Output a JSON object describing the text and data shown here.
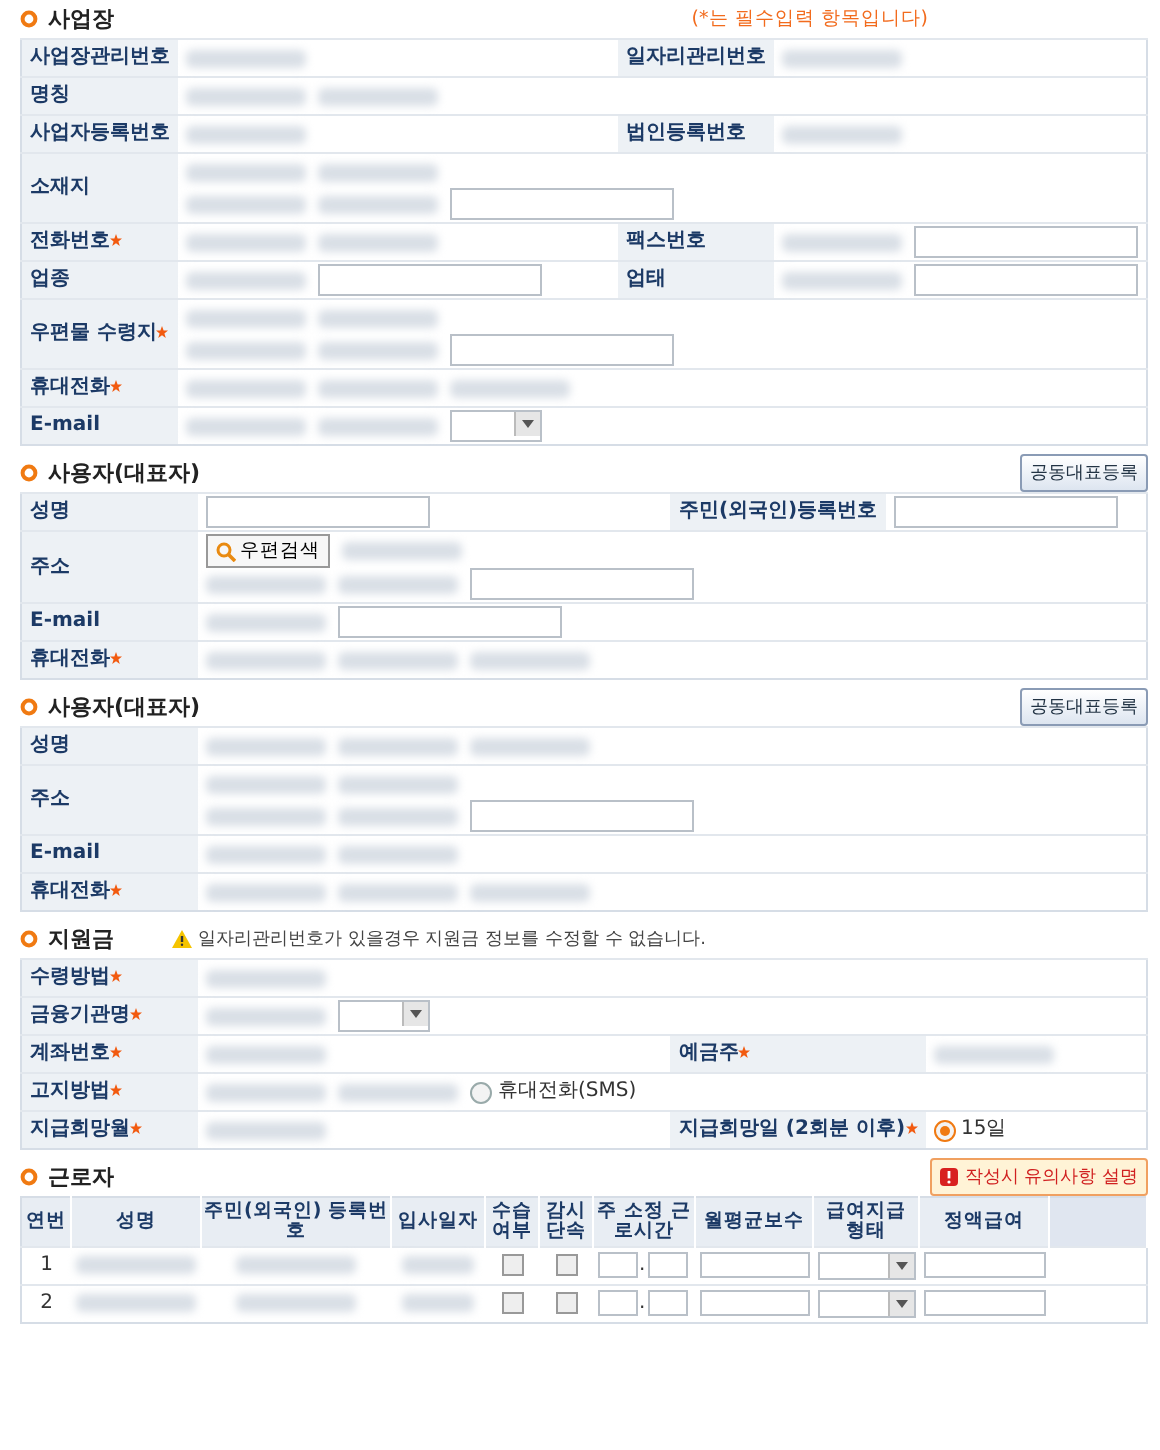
{
  "sections": [
    {
      "kind": "form",
      "title": "사업장",
      "notice": {
        "kind": "hint",
        "text": "(*는 필수입력 항목입니다)"
      },
      "rows": [
        {
          "label": "사업장관리번호",
          "required": false,
          "lines": [
            [
              {
                "kind": "blur"
              }
            ]
          ],
          "label2": "일자리관리번호",
          "required2": false,
          "lines2": [
            [
              {
                "kind": "blur"
              }
            ]
          ]
        },
        {
          "label": "명칭",
          "required": false,
          "lines": [
            [
              {
                "kind": "blur"
              },
              {
                "kind": "blur"
              }
            ]
          ]
        },
        {
          "label": "사업자등록번호",
          "required": false,
          "lines": [
            [
              {
                "kind": "blur"
              }
            ]
          ],
          "label2": "법인등록번호",
          "required2": false,
          "lines2": [
            [
              {
                "kind": "blur"
              }
            ]
          ]
        },
        {
          "label": "소재지",
          "required": false,
          "lines": [
            [
              {
                "kind": "blur"
              },
              {
                "kind": "blur"
              }
            ],
            [
              {
                "kind": "blur"
              },
              {
                "kind": "blur"
              },
              {
                "kind": "field"
              }
            ]
          ]
        },
        {
          "label": "전화번호",
          "required": true,
          "lines": [
            [
              {
                "kind": "blur"
              },
              {
                "kind": "blur"
              }
            ]
          ],
          "label2": "팩스번호",
          "required2": false,
          "lines2": [
            [
              {
                "kind": "blur"
              },
              {
                "kind": "field"
              }
            ]
          ]
        },
        {
          "label": "업종",
          "required": false,
          "lines": [
            [
              {
                "kind": "blur"
              },
              {
                "kind": "field"
              }
            ]
          ],
          "label2": "업태",
          "required2": false,
          "lines2": [
            [
              {
                "kind": "blur"
              },
              {
                "kind": "field"
              }
            ]
          ]
        },
        {
          "label": "우편물 수령지",
          "required": true,
          "lines": [
            [
              {
                "kind": "blur"
              },
              {
                "kind": "blur"
              }
            ],
            [
              {
                "kind": "blur"
              },
              {
                "kind": "blur"
              },
              {
                "kind": "field"
              }
            ]
          ]
        },
        {
          "label": "휴대전화",
          "required": true,
          "lines": [
            [
              {
                "kind": "blur"
              },
              {
                "kind": "blur"
              },
              {
                "kind": "blur"
              }
            ]
          ]
        },
        {
          "label": "E-mail",
          "required": false,
          "lines": [
            [
              {
                "kind": "blur"
              },
              {
                "kind": "blur"
              },
              {
                "kind": "select"
              }
            ]
          ]
        }
      ]
    },
    {
      "kind": "form",
      "title": "사용자(대표자)",
      "action": {
        "kind": "plain",
        "label": "공동대표등록"
      },
      "rows": [
        {
          "label": "성명",
          "required": false,
          "lines": [
            [
              {
                "kind": "field"
              }
            ]
          ],
          "label2": "주민(외국인)등록번호",
          "required2": false,
          "lines2": [
            [
              {
                "kind": "field"
              }
            ]
          ]
        },
        {
          "label": "주소",
          "required": false,
          "lines": [
            [
              {
                "kind": "search",
                "label": "우편검색"
              },
              {
                "kind": "blur"
              }
            ],
            [
              {
                "kind": "blur"
              },
              {
                "kind": "blur"
              },
              {
                "kind": "field"
              }
            ]
          ]
        },
        {
          "label": "E-mail",
          "required": false,
          "lines": [
            [
              {
                "kind": "blur"
              },
              {
                "kind": "field"
              }
            ]
          ]
        },
        {
          "label": "휴대전화",
          "required": true,
          "lines": [
            [
              {
                "kind": "blur"
              },
              {
                "kind": "blur"
              },
              {
                "kind": "blur"
              }
            ]
          ]
        }
      ]
    },
    {
      "kind": "form",
      "title": "사용자(대표자)",
      "action": {
        "kind": "plain",
        "label": "공동대표등록"
      },
      "rows": [
        {
          "label": "성명",
          "required": false,
          "lines": [
            [
              {
                "kind": "blur"
              },
              {
                "kind": "blur"
              },
              {
                "kind": "blur"
              }
            ]
          ]
        },
        {
          "label": "주소",
          "required": false,
          "lines": [
            [
              {
                "kind": "blur"
              },
              {
                "kind": "blur"
              }
            ],
            [
              {
                "kind": "blur"
              },
              {
                "kind": "blur"
              },
              {
                "kind": "field"
              }
            ]
          ]
        },
        {
          "label": "E-mail",
          "required": false,
          "lines": [
            [
              {
                "kind": "blur"
              },
              {
                "kind": "blur"
              }
            ]
          ]
        },
        {
          "label": "휴대전화",
          "required": true,
          "lines": [
            [
              {
                "kind": "blur"
              },
              {
                "kind": "blur"
              },
              {
                "kind": "blur"
              }
            ]
          ]
        }
      ]
    },
    {
      "kind": "form",
      "title": "지원금",
      "notice": {
        "kind": "warning",
        "text": "일자리관리번호가 있을경우 지원금 정보를 수정할 수 없습니다."
      },
      "rows": [
        {
          "label": "수령방법",
          "required": true,
          "lines": [
            [
              {
                "kind": "blur"
              }
            ]
          ]
        },
        {
          "label": "금융기관명",
          "required": true,
          "lines": [
            [
              {
                "kind": "blur"
              },
              {
                "kind": "select"
              }
            ]
          ]
        },
        {
          "label": "계좌번호",
          "required": true,
          "lines": [
            [
              {
                "kind": "blur"
              }
            ]
          ],
          "label2": "예금주",
          "required2": true,
          "lines2": [
            [
              {
                "kind": "blur"
              }
            ]
          ]
        },
        {
          "label": "고지방법",
          "required": true,
          "lines": [
            [
              {
                "kind": "blur"
              },
              {
                "kind": "blur"
              },
              {
                "kind": "radio",
                "label": "휴대전화(SMS)",
                "selected": false
              }
            ]
          ]
        },
        {
          "label": "지급희망월",
          "required": true,
          "lines": [
            [
              {
                "kind": "blur"
              }
            ]
          ],
          "label2": "지급희망일 (2회분 이후)",
          "required2": true,
          "lines2": [
            [
              {
                "kind": "radio",
                "label": "15일",
                "selected": true
              }
            ]
          ]
        }
      ]
    },
    {
      "kind": "table",
      "title": "근로자",
      "action": {
        "kind": "alert",
        "label": "작성시 유의사항 설명"
      },
      "columns": [
        "연번",
        "성명",
        "주민(외국인) 등록번호",
        "입사일자",
        "수습 여부",
        "감시 단속",
        "주 소정 근로시간",
        "월평균보수",
        "급여지급 형태",
        "정액급여"
      ],
      "rows": [
        {
          "number": "1",
          "probation": false,
          "surveillance": false,
          "hours_separator": "."
        },
        {
          "number": "2",
          "probation": false,
          "surveillance": false,
          "hours_separator": "."
        }
      ]
    }
  ]
}
